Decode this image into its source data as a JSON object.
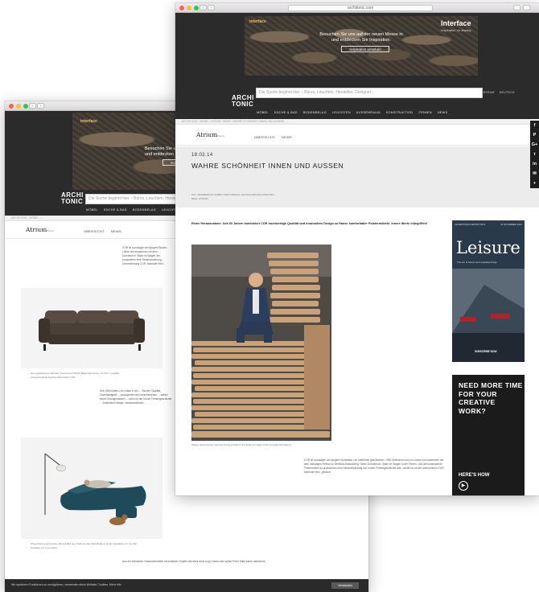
{
  "back_window": {
    "url": "",
    "banner": {
      "brand": "interface",
      "text": "Besuchen Sie uns auf der neuen Messe in",
      "text2": "und entdecken Sie Inspiration.",
      "cta": "Inspiration"
    },
    "logo_line1": "ARCHI",
    "logo_line2": "TONIC",
    "search_placeholder": "Die Suche beginnt hier – Büros, Leuchten, Hersteller, Designer...",
    "nav": [
      "MÖBEL",
      "KÜCHE & BAD",
      "BODENBELAG",
      "LEUCHTEN",
      "AUSSE"
    ],
    "breadcrumb": "ARCHITONIC  ›  MÖBEL  ›  ...",
    "brand_name": "Atrium",
    "brand_suffix": "Raum",
    "brand_nav": [
      "ÜBERSICHT",
      "NEWS"
    ],
    "para1": "COR ist sozusagen der jüngere Bruder... Lübke und zusammen mit dem... Durchbruch: Sitzte im Wagen der... produzieren eine Herausforderung... Unternehmung COR, bedeutet Herz...",
    "caption1": "Jung gebliebenes Sitzsofa: Konsequent Martin Ballendat-Design, Komfort, Qualität.",
    "caption1b": "Ausgezeichnete Polstermöbel bleibt COR.",
    "para2": "Seit 1954 hatten Leo Lübke in der ... Sachen Qualität, Zuverlässigkeit ... produzierten aus verschiedenen ... wieder einen Grundgedanken ... schon in der frühen Firmengeschichte ... Zeitlichkeit Design, verantwortlichen ...",
    "caption2": "Abwechslung auf Großes: Bestandteil des Sofas ist das Sofa Mödest mit der Gestaltung im Cor-Stil.",
    "caption2b": "Gestaltet von Leo Lübke.",
    "para3": "Aus der intensiven Zusammenarbeit mit kreativen Köpfen wie etwa einst Luigi Colani oder später Peter Maly waren zahlreiche...",
    "cookie_text": "Wir speichern Funktionen zu ermöglichen, verwenden diese Website Cookies. Mehr Info",
    "cookie_button": "Verstanden"
  },
  "front_window": {
    "url": "architonic.com",
    "banner": {
      "brand": "interface",
      "text": "Besuchen Sie uns auf der neuen Messe in",
      "text2": "und entdecken Sie Inspiration.",
      "cta": "Inspiration ansehen",
      "logo": "Interface",
      "logo_sub": "Inspiration on display"
    },
    "logo_line1": "ARCHI",
    "logo_line2": "TONIC",
    "search_placeholder": "Die Suche beginnt hier – Büros, Leuchten, Hersteller, Designer...",
    "toplinks": [
      "ANMELDEN",
      "NEWSLETTER",
      "LINKS",
      "KONTAKT",
      "IMPRESSUM",
      "DEUTSCH"
    ],
    "nav": [
      "MÖBEL",
      "KÜCHE & BAD",
      "BODENBELAG",
      "LEUCHTEN",
      "AUSSENRAUM",
      "KONSTRUKTION",
      "FIRMEN",
      "NEWS"
    ],
    "breadcrumb": "ARCHITONIC  ›  MÖBEL  ›  ATRIUM  ›  NEWS  ›  WAHRE SCHÖNHEIT INNEN UND AUSSEN",
    "brand_name": "Atrium",
    "brand_suffix": "Raum",
    "brand_nav": [
      "ÜBERSICHT",
      "NEWS"
    ],
    "date": "18.02.14",
    "headline": "WAHRE SCHÖNHEIT INNEN UND AUSSEN",
    "byline1": "Text: ANGEBRACHT ARBEIT TEXT DESIGN, ANLAGE DES ARCHITEKTEN",
    "byline2": "Bilder: ATRIUM",
    "lead": "Reine Herausnahme: Seit 60 Jahren kombiniert COR hochwertige Qualität und innovatives Design zu Hause komfortabler Polstermöbeln. Innere Werte inbegriffen!",
    "photo_caption": "Weltig. Niederberger Gerhard Stroht erzählt zu am Ende der Halle COR (Ausgabe/Schrägen).",
    "body": "COR ist sozusagen der jüngere Schwester von Interlübke geschrieben. 1954 übernahm von Leo Lübke und zusammen mit dem damaligen Helmut zu Berthold-Hassenberg. Seine Durchbruch: Sitzte im Wagen in der Firmen. Und die konsequente Polstermöbel zu produzieren eine Herausforderung hat, innere Firmengeschichte was. wurde ein neuer Unternehmen COR, bedeutet Herz, gewinnt.",
    "ad1": {
      "top_left": "ADVERTISING REPORT 2014",
      "top_right": "10 NOVEMBER 2014",
      "title": "Leisure",
      "subtitle": "The rise of leisure and hospitality design",
      "cta": "SUBSCRIBE NOW"
    },
    "ad2": {
      "headline": "NEED MORE TIME FOR YOUR CREATIVE WORK?",
      "cta": "HERE'S HOW"
    },
    "social": [
      "f",
      "P",
      "G+",
      "t",
      "in",
      "✉",
      "+"
    ]
  }
}
